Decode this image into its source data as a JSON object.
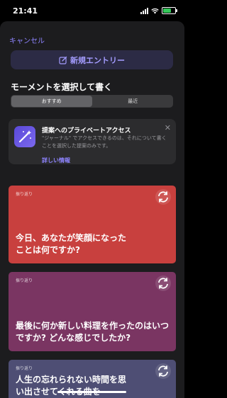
{
  "status": {
    "time": "21:41"
  },
  "header": {
    "cancel_label": "キャンセル"
  },
  "new_entry": {
    "label": "新規エントリー"
  },
  "section": {
    "title": "モーメントを選択して書く"
  },
  "segments": [
    {
      "label": "おすすめ",
      "active": true
    },
    {
      "label": "最近",
      "active": false
    }
  ],
  "privacy_card": {
    "title": "提案へのプライベートアクセス",
    "body": "\"ジャーナル\" でアクセスできるのは、それについて書くことを選択した提案のみです。",
    "link": "詳しい情報"
  },
  "cards": [
    {
      "tag": "振り返り",
      "question": "今日、あなたが笑顔になったことは何ですか?",
      "color": "#c8403e"
    },
    {
      "tag": "振り返り",
      "question": "最後に何か新しい料理を作ったのはいつですか? どんな感じでしたか?",
      "color": "#7a3562"
    },
    {
      "tag": "振り返り",
      "question": "人生の忘れられない時間を思い出させてくれる曲を",
      "color": "#4e4e74"
    }
  ],
  "colors": {
    "accent": "#8e84ff",
    "sheet": "#1c1c1e"
  }
}
